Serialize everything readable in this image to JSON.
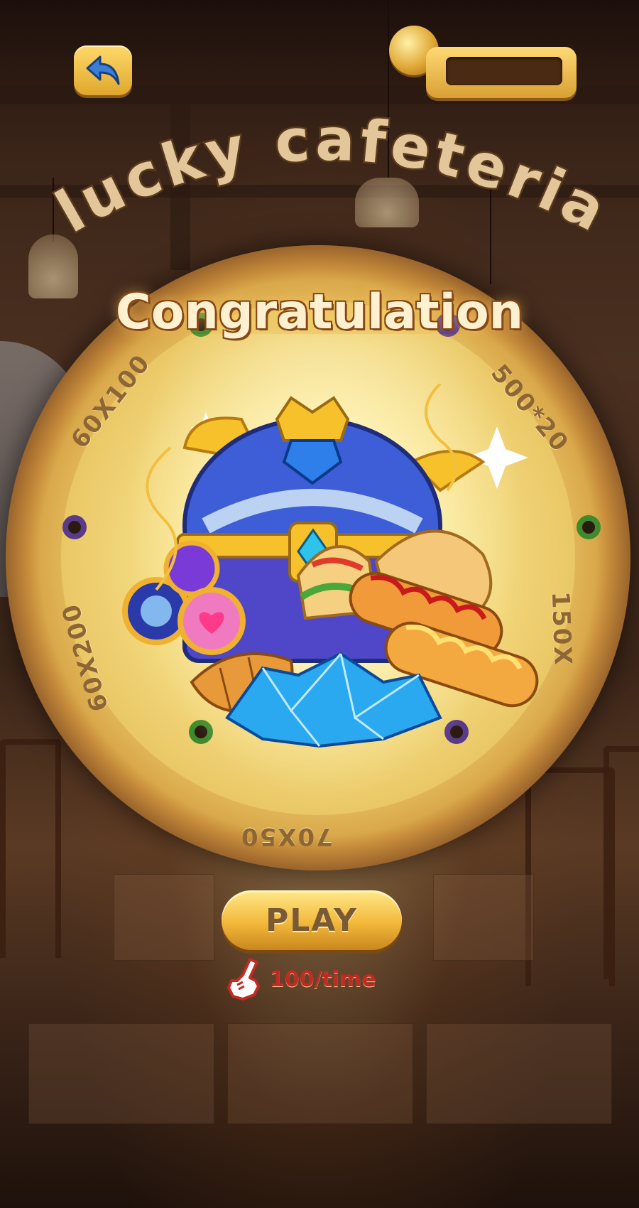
{
  "game": {
    "title": "lucky cafeteria",
    "congrats_text": "Congratulation"
  },
  "header": {
    "back_icon": "back-arrow-icon",
    "coin_balance": ""
  },
  "wheel": {
    "segments": [
      "60X100",
      "500*20",
      "150X",
      "70X50",
      "60X200"
    ]
  },
  "reward": {
    "items": [
      "treasure-chest",
      "magic-orbs",
      "blue-gems",
      "croissant",
      "hot-dogs",
      "taco",
      "sandwich"
    ]
  },
  "actions": {
    "play_label": "PLAY",
    "cost_label": "100/time",
    "cost_icon": "pointing-hand-icon"
  },
  "colors": {
    "accent_gold": "#f2b83a",
    "cost_red": "#c22a22",
    "title_tan": "#e3c79a"
  }
}
